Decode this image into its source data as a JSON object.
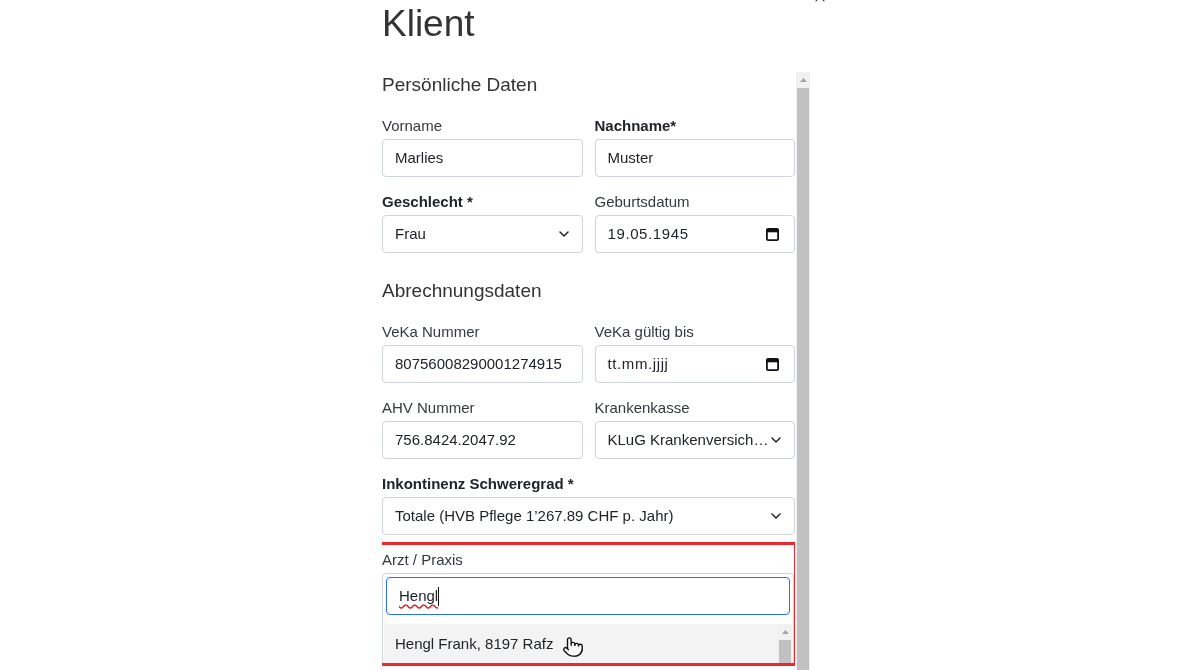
{
  "dialog": {
    "title": "Klient",
    "sections": [
      {
        "heading": "Persönliche Daten",
        "rows": [
          [
            {
              "label": "Vorname",
              "required": false,
              "kind": "text",
              "value": "Marlies"
            },
            {
              "label": "Nachname*",
              "required": true,
              "kind": "text",
              "value": "Muster"
            }
          ],
          [
            {
              "label": "Geschlecht *",
              "required": true,
              "kind": "select",
              "value": "Frau"
            },
            {
              "label": "Geburtsdatum",
              "required": false,
              "kind": "date",
              "value": "19.05.1945"
            }
          ]
        ]
      },
      {
        "heading": "Abrechnungsdaten",
        "rows": [
          [
            {
              "label": "VeKa Nummer",
              "required": false,
              "kind": "text",
              "value": "80756008290001274915"
            },
            {
              "label": "VeKa gültig bis",
              "required": false,
              "kind": "date",
              "placeholder": "tt.mm.jjjj"
            }
          ],
          [
            {
              "label": "AHV Nummer",
              "required": false,
              "kind": "text",
              "value": "756.8424.2047.92"
            },
            {
              "label": "Krankenkasse",
              "required": false,
              "kind": "select",
              "value": "KLuG Krankenversich…"
            }
          ],
          [
            {
              "label": "Inkontinenz Schweregrad *",
              "required": true,
              "kind": "select",
              "value": "Totale (HVB Pflege 1’267.89 CHF p. Jahr)"
            }
          ]
        ]
      }
    ],
    "doctor_lookup": {
      "label": "Arzt / Praxis",
      "required": false,
      "highlighted": true,
      "search": {
        "value": "Hengl",
        "focused": true,
        "spelling_error": true
      },
      "options": [
        {
          "text": "Hengl Frank, 8197 Rafz",
          "selected": true
        }
      ]
    }
  }
}
